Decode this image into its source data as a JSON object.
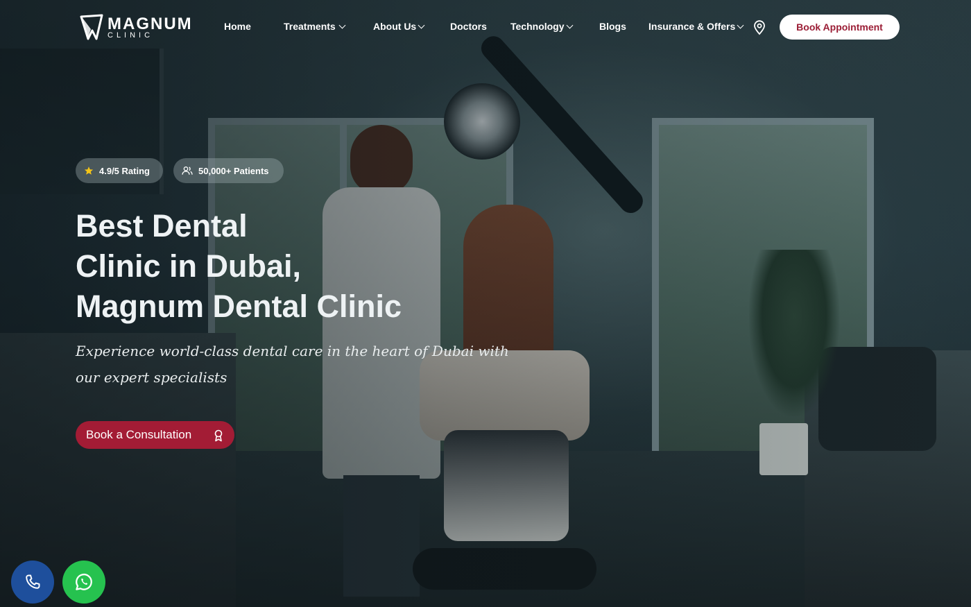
{
  "brand": {
    "name": "MAGNUM",
    "tagline": "CLINIC"
  },
  "nav": {
    "items": [
      {
        "label": "Home",
        "has_dropdown": false
      },
      {
        "label": "Treatments",
        "has_dropdown": true
      },
      {
        "label": "About Us",
        "has_dropdown": true
      },
      {
        "label": "Doctors",
        "has_dropdown": false
      },
      {
        "label": "Technology",
        "has_dropdown": true
      },
      {
        "label": "Blogs",
        "has_dropdown": false
      },
      {
        "label": "Insurance & Offers",
        "has_dropdown": true
      }
    ],
    "location_icon": "map-pin-icon",
    "cta_label": "Book Appointment"
  },
  "hero": {
    "badges": [
      {
        "icon": "star-icon",
        "label": "4.9/5 Rating"
      },
      {
        "icon": "users-icon",
        "label": "50,000+ Patients"
      }
    ],
    "title_lines": [
      "Best Dental",
      "Clinic in Dubai,",
      "Magnum Dental Clinic"
    ],
    "subtitle_lines": [
      "Experience world-class dental care in the heart of Dubai with",
      "our expert specialists"
    ],
    "cta_label": "Book a Consultation",
    "cta_icon": "award-icon"
  },
  "floating": {
    "phone_icon": "phone-icon",
    "whatsapp_icon": "whatsapp-icon"
  },
  "colors": {
    "accent": "#a31c35",
    "cta_text": "#9b1d35",
    "phone_button": "#1e4f9c",
    "whatsapp_button": "#26c24f",
    "star": "#f5c518"
  }
}
